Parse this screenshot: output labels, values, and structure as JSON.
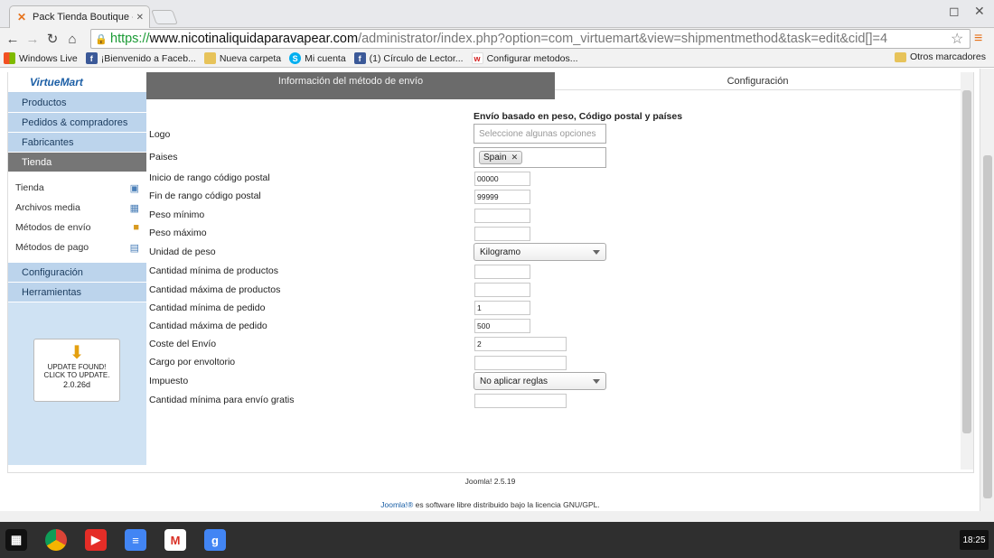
{
  "browser": {
    "tab_title": "Pack Tienda Boutique - A",
    "url_scheme": "https://",
    "url_domain": "www.nicotinaliquidaparavapear.com",
    "url_path": "/administrator/index.php?option=com_virtuemart&view=shipmentmethod&task=edit&cid[]=4",
    "bookmarks": [
      "Windows Live",
      "¡Bienvenido a Faceb...",
      "Nueva carpeta",
      "Mi cuenta",
      "(1) Círculo de Lector...",
      "Configurar metodos..."
    ],
    "other_bookmarks": "Otros marcadores"
  },
  "sidebar": {
    "logo": "VirtueMart",
    "top_items": [
      "Productos",
      "Pedidos & compradores",
      "Fabricantes"
    ],
    "active_item": "Tienda",
    "sub_items": [
      "Tienda",
      "Archivos media",
      "Métodos de envío",
      "Métodos de pago"
    ],
    "bottom_items": [
      "Configuración",
      "Herramientas"
    ],
    "update": {
      "line1": "UPDATE FOUND!",
      "line2": "CLICK TO UPDATE.",
      "version": "2.0.26d"
    }
  },
  "tabs": {
    "info": "Información del método de envío",
    "config": "Configuración"
  },
  "form": {
    "heading": "Envío basado en peso, Código postal y países",
    "logo_label": "Logo",
    "logo_placeholder": "Seleccione algunas opciones",
    "countries_label": "Paises",
    "country_chip": "Spain",
    "zip_start_label": "Inicio de rango código postal",
    "zip_start_value": "00000",
    "zip_end_label": "Fin de rango código postal",
    "zip_end_value": "99999",
    "weight_min_label": "Peso mínimo",
    "weight_max_label": "Peso máximo",
    "weight_unit_label": "Unidad de peso",
    "weight_unit_value": "Kilogramo",
    "prod_min_label": "Cantidad mínima de productos",
    "prod_max_label": "Cantidad máxima de productos",
    "order_min_label": "Cantidad mínima de pedido",
    "order_min_value": "1",
    "order_max_label": "Cantidad máxima de pedido",
    "order_max_value": "500",
    "cost_label": "Coste del Envío",
    "cost_value": "2",
    "package_label": "Cargo por envoltorio",
    "tax_label": "Impuesto",
    "tax_value": "No aplicar reglas",
    "free_label": "Cantidad mínima para envío gratis"
  },
  "footer": {
    "version": "Joomla! 2.5.19",
    "joomla_link": "Joomla!®",
    "license": " es software libre distribuido bajo la licencia GNU/GPL."
  },
  "taskbar": {
    "clock": "18:25"
  }
}
